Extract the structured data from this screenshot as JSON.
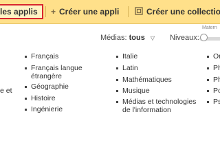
{
  "toolbar": {
    "active_label": "les applis",
    "create_app": {
      "icon": "plus-icon",
      "label": "Créer une appli"
    },
    "create_collection": {
      "icon": "collection-icon",
      "label": "Créer une collection"
    },
    "colors": {
      "background": "#ffe08a",
      "active_border": "#d9262e"
    }
  },
  "filters": {
    "media_label": "Médias:",
    "media_value": "tous",
    "levels_label": "Niveaux:",
    "slider_caption": "Matern"
  },
  "subjects": {
    "col0": [
      "e et"
    ],
    "col1": [
      "Français",
      "Français langue étrangère",
      "Géographie",
      "Histoire",
      "Ingénierie"
    ],
    "col2": [
      "Italie",
      "Latin",
      "Mathématiques",
      "Musique",
      "Médias et technologies de l'information"
    ],
    "col3": [
      "Or",
      "Ph",
      "Ph",
      "Po",
      "Ps"
    ]
  }
}
